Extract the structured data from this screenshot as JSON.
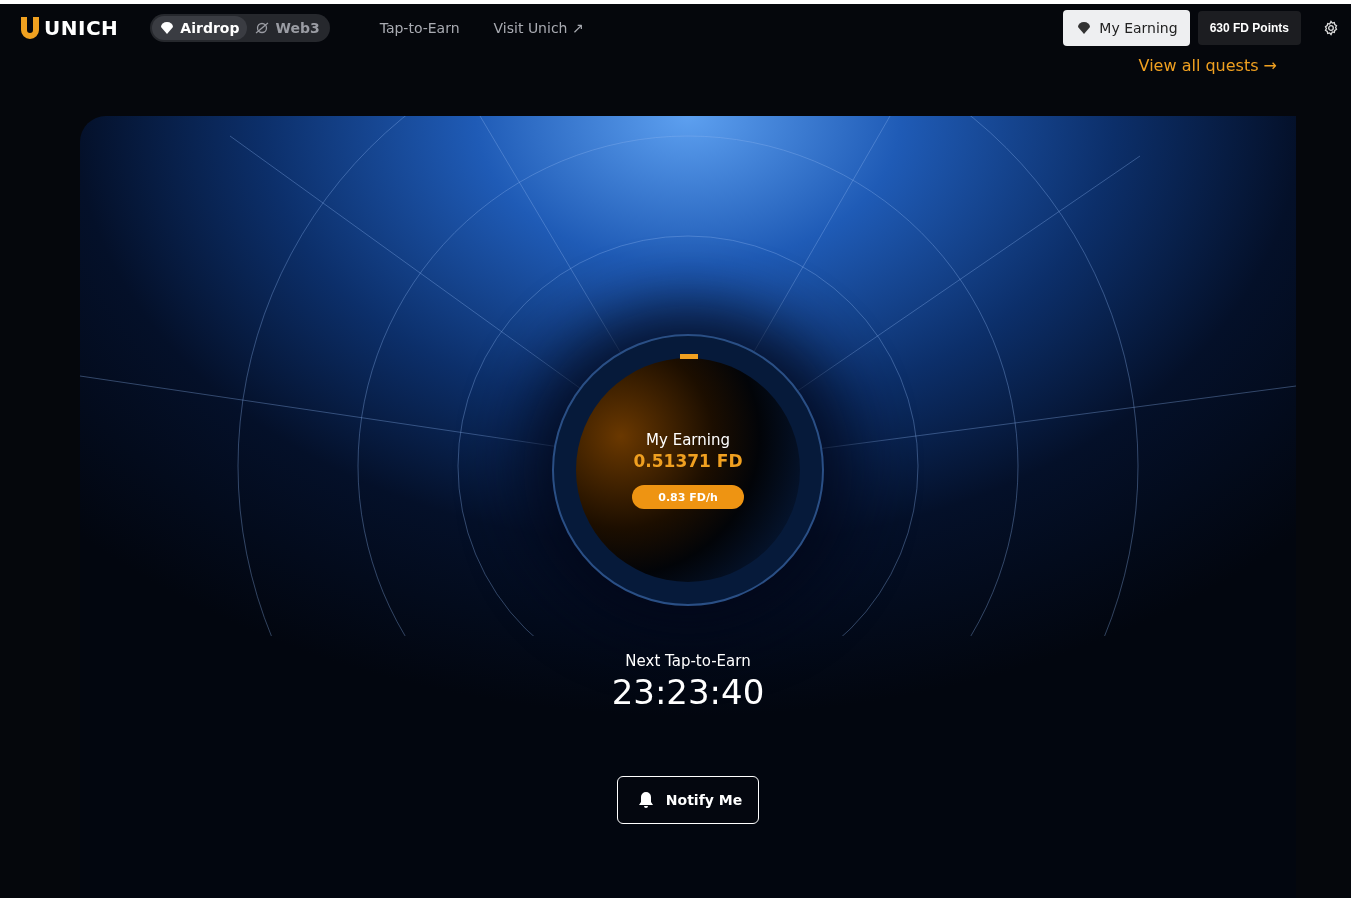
{
  "header": {
    "logo": "UNICH",
    "tabs": [
      {
        "label": "Airdrop",
        "selected": true
      },
      {
        "label": "Web3",
        "selected": false
      }
    ],
    "links": [
      "Tap-to-Earn",
      "Visit Unich ↗"
    ],
    "earning_button": "My Earning",
    "points": "630 FD Points"
  },
  "quests_link": "View all quests →",
  "earning": {
    "title": "My Earning",
    "amount": "0.51371 FD",
    "rate": "0.83 FD/h"
  },
  "countdown": {
    "label": "Next Tap-to-Earn",
    "time": "23:23:40"
  },
  "notify_button": "Notify Me"
}
